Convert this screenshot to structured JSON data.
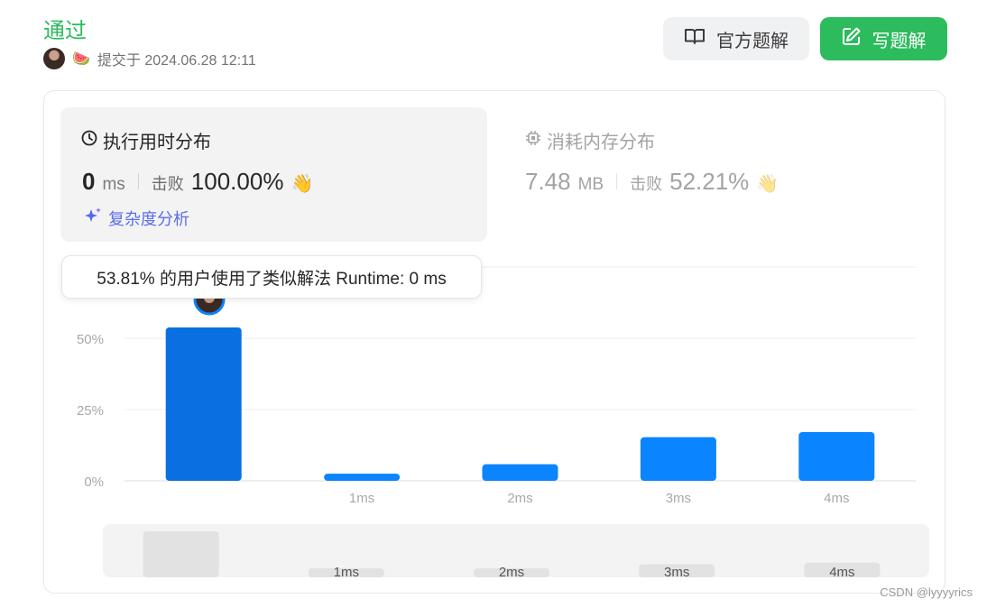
{
  "submission": {
    "status": "通过",
    "submitted_text": "提交于 2024.06.28 12:11"
  },
  "buttons": {
    "official_solution": "官方题解",
    "write_solution": "写题解"
  },
  "runtime": {
    "title": "执行用时分布",
    "value": "0",
    "unit": "ms",
    "beat_label": "击败",
    "beat_pct": "100.00%"
  },
  "memory": {
    "title": "消耗内存分布",
    "value": "7.48",
    "unit": "MB",
    "beat_label": "击败",
    "beat_pct": "52.21%"
  },
  "complexity_link": "复杂度分析",
  "tooltip": "53.81% 的用户使用了类似解法 Runtime: 0 ms",
  "watermark": "CSDN @lyyyyrics",
  "colors": {
    "accent_green": "#2cbb5d",
    "bar_selected": "#0a6fe0",
    "bar": "#0a84ff"
  },
  "chart_data": {
    "type": "bar",
    "categories": [
      "",
      "1ms",
      "2ms",
      "3ms",
      "4ms"
    ],
    "values": [
      53.81,
      2.5,
      5.8,
      15.3,
      17.1
    ],
    "highlight_index": 0,
    "y_ticks": [
      "0%",
      "25%",
      "50%"
    ],
    "ylim": [
      0,
      75
    ],
    "grid": true,
    "navigator": {
      "categories": [
        "",
        "1ms",
        "2ms",
        "3ms",
        "4ms"
      ],
      "values": [
        53.81,
        2.5,
        2.5,
        15.3,
        17.1
      ]
    }
  }
}
